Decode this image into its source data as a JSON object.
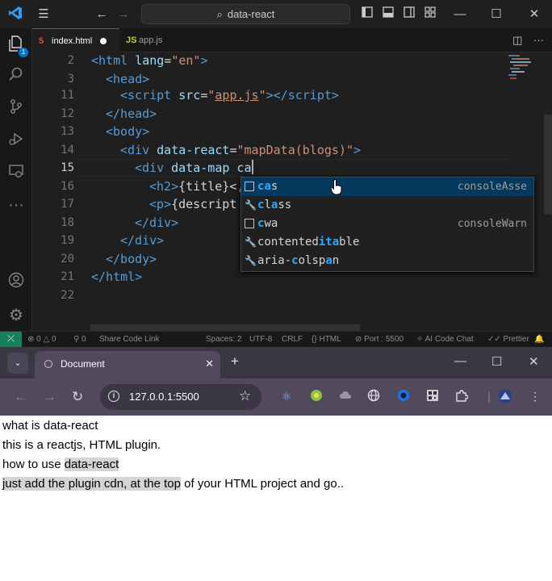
{
  "vscode": {
    "search": "data-react",
    "tabs": [
      {
        "name": "index.html",
        "icon": "html5-icon",
        "dirty": true,
        "active": true
      },
      {
        "name": "app.js",
        "icon": "js-icon",
        "active": false
      }
    ],
    "explorer_badge": "1",
    "line_numbers": [
      "2",
      "3",
      "11",
      "12",
      "13",
      "14",
      "15",
      "16",
      "17",
      "18",
      "19",
      "20",
      "21",
      "22"
    ],
    "current_line": "15",
    "code": {
      "l2": {
        "tag_open": "<html ",
        "attr": "lang",
        "eq": "=",
        "val": "\"en\"",
        "close": ">"
      },
      "l3": {
        "tag": "<head>"
      },
      "l11": {
        "open": "<script ",
        "attr": "src",
        "eq": "=",
        "val_q1": "\"",
        "val": "app.js",
        "val_q2": "\"",
        "mid": "></",
        "end": "script>"
      },
      "l12": {
        "tag": "</head>"
      },
      "l13": {
        "tag": "<body>"
      },
      "l14": {
        "open": "<div ",
        "attr": "data-react",
        "eq": "=",
        "val": "\"mapData(blogs)\"",
        "close": ">"
      },
      "l15": {
        "open": "<div ",
        "attr": "data-map",
        "typed": " ca"
      },
      "l16": {
        "open": "<h2>",
        "text": "{title}<,"
      },
      "l17": {
        "open": "<p>",
        "text": "{descript"
      },
      "l18": {
        "tag": "</div>"
      },
      "l19": {
        "tag": "</div>"
      },
      "l20": {
        "tag": "</body>"
      },
      "l21": {
        "tag": "</html>"
      }
    },
    "suggestions": [
      {
        "match": "ca",
        "rest": "s",
        "kind": "word",
        "detail": "consoleAsse",
        "selected": true
      },
      {
        "match": "c",
        "mid": "l",
        "match2": "a",
        "rest": "ss",
        "kind": "wrench",
        "detail": ""
      },
      {
        "match": "c",
        "rest": "wa",
        "kind": "word",
        "detail": "consoleWarn"
      },
      {
        "pre": "contented",
        "match": "ita",
        "rest": "ble",
        "kind": "wrench",
        "detail": ""
      },
      {
        "pre": "aria-",
        "match": "c",
        "mid": "olsp",
        "match2": "a",
        "rest": "n",
        "kind": "wrench",
        "detail": ""
      }
    ],
    "status": {
      "errors": "0",
      "warnings": "0",
      "ports": "0",
      "share": "Share Code Link",
      "spaces": "Spaces: 2",
      "encoding": "UTF-8",
      "eol": "CRLF",
      "lang": "HTML",
      "port": "Port : 5500",
      "ai": "AI Code Chat",
      "prettier": "Prettier"
    }
  },
  "browser": {
    "tab_title": "Document",
    "url": "127.0.0.1:5500",
    "lines": [
      {
        "plain": "what is data-react",
        "hl": "",
        "after": ""
      },
      {
        "plain": "this is a reactjs, HTML plugin.",
        "hl": "",
        "after": ""
      },
      {
        "plain": "how to use ",
        "hl": "data-react",
        "after": ""
      },
      {
        "plain": "",
        "hl": "just add the plugin cdn, at the top",
        "after": " of your HTML project and go.."
      }
    ]
  }
}
